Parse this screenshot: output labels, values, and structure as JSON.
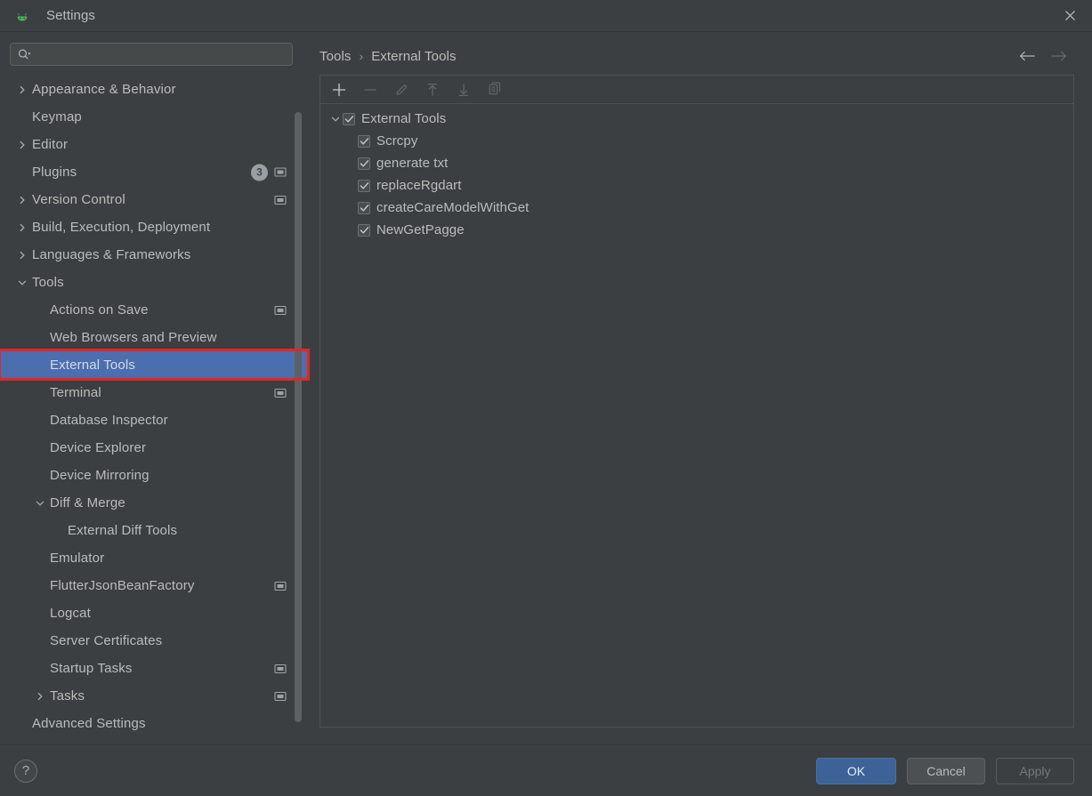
{
  "window": {
    "title": "Settings",
    "app_icon": "android-icon",
    "close_icon": "close-icon"
  },
  "search": {
    "value": "",
    "placeholder": "",
    "icon": "search-icon"
  },
  "sidebar": {
    "items": [
      {
        "label": "Appearance & Behavior",
        "chevron": "chevron-right",
        "indent": 0,
        "selected": false,
        "badge": "",
        "scope_icon": false
      },
      {
        "label": "Keymap",
        "chevron": "none",
        "indent": 0,
        "selected": false,
        "badge": "",
        "scope_icon": false
      },
      {
        "label": "Editor",
        "chevron": "chevron-right",
        "indent": 0,
        "selected": false,
        "badge": "",
        "scope_icon": false
      },
      {
        "label": "Plugins",
        "chevron": "none",
        "indent": 0,
        "selected": false,
        "badge": "3",
        "scope_icon": true
      },
      {
        "label": "Version Control",
        "chevron": "chevron-right",
        "indent": 0,
        "selected": false,
        "badge": "",
        "scope_icon": true
      },
      {
        "label": "Build, Execution, Deployment",
        "chevron": "chevron-right",
        "indent": 0,
        "selected": false,
        "badge": "",
        "scope_icon": false
      },
      {
        "label": "Languages & Frameworks",
        "chevron": "chevron-right",
        "indent": 0,
        "selected": false,
        "badge": "",
        "scope_icon": false
      },
      {
        "label": "Tools",
        "chevron": "chevron-down",
        "indent": 0,
        "selected": false,
        "badge": "",
        "scope_icon": false
      },
      {
        "label": "Actions on Save",
        "chevron": "none",
        "indent": 1,
        "selected": false,
        "badge": "",
        "scope_icon": true
      },
      {
        "label": "Web Browsers and Preview",
        "chevron": "none",
        "indent": 1,
        "selected": false,
        "badge": "",
        "scope_icon": false
      },
      {
        "label": "External Tools",
        "chevron": "none",
        "indent": 1,
        "selected": true,
        "badge": "",
        "scope_icon": false
      },
      {
        "label": "Terminal",
        "chevron": "none",
        "indent": 1,
        "selected": false,
        "badge": "",
        "scope_icon": true
      },
      {
        "label": "Database Inspector",
        "chevron": "none",
        "indent": 1,
        "selected": false,
        "badge": "",
        "scope_icon": false
      },
      {
        "label": "Device Explorer",
        "chevron": "none",
        "indent": 1,
        "selected": false,
        "badge": "",
        "scope_icon": false
      },
      {
        "label": "Device Mirroring",
        "chevron": "none",
        "indent": 1,
        "selected": false,
        "badge": "",
        "scope_icon": false
      },
      {
        "label": "Diff & Merge",
        "chevron": "chevron-down",
        "indent": 1,
        "selected": false,
        "badge": "",
        "scope_icon": false
      },
      {
        "label": "External Diff Tools",
        "chevron": "none",
        "indent": 2,
        "selected": false,
        "badge": "",
        "scope_icon": false
      },
      {
        "label": "Emulator",
        "chevron": "none",
        "indent": 1,
        "selected": false,
        "badge": "",
        "scope_icon": false
      },
      {
        "label": "FlutterJsonBeanFactory",
        "chevron": "none",
        "indent": 1,
        "selected": false,
        "badge": "",
        "scope_icon": true
      },
      {
        "label": "Logcat",
        "chevron": "none",
        "indent": 1,
        "selected": false,
        "badge": "",
        "scope_icon": false
      },
      {
        "label": "Server Certificates",
        "chevron": "none",
        "indent": 1,
        "selected": false,
        "badge": "",
        "scope_icon": false
      },
      {
        "label": "Startup Tasks",
        "chevron": "none",
        "indent": 1,
        "selected": false,
        "badge": "",
        "scope_icon": true
      },
      {
        "label": "Tasks",
        "chevron": "chevron-right",
        "indent": 1,
        "selected": false,
        "badge": "",
        "scope_icon": true
      },
      {
        "label": "Advanced Settings",
        "chevron": "none",
        "indent": 0,
        "selected": false,
        "badge": "",
        "scope_icon": false
      }
    ]
  },
  "breadcrumb": {
    "parent": "Tools",
    "separator": "›",
    "current": "External Tools"
  },
  "navigation": {
    "back_icon": "arrow-left-icon",
    "back_enabled": true,
    "forward_icon": "arrow-right-icon",
    "forward_enabled": false
  },
  "toolbar": {
    "buttons": [
      {
        "name": "add-button",
        "icon": "plus-icon",
        "enabled": true
      },
      {
        "name": "remove-button",
        "icon": "minus-icon",
        "enabled": false
      },
      {
        "name": "edit-button",
        "icon": "pencil-icon",
        "enabled": false
      },
      {
        "name": "move-up-button",
        "icon": "arrow-up-icon",
        "enabled": false
      },
      {
        "name": "move-down-button",
        "icon": "arrow-down-icon",
        "enabled": false
      },
      {
        "name": "copy-button",
        "icon": "copy-icon",
        "enabled": false
      }
    ]
  },
  "tools_tree": {
    "root": {
      "label": "External Tools",
      "checked": true,
      "expanded": true,
      "chevron": "chevron-down"
    },
    "children": [
      {
        "label": "Scrcpy",
        "checked": true
      },
      {
        "label": "generate txt",
        "checked": true
      },
      {
        "label": "replaceRgdart",
        "checked": true
      },
      {
        "label": "createCareModelWithGet",
        "checked": true
      },
      {
        "label": "NewGetPagge",
        "checked": true
      }
    ]
  },
  "footer": {
    "help_label": "?",
    "ok_label": "OK",
    "cancel_label": "Cancel",
    "apply_label": "Apply",
    "apply_enabled": false
  },
  "colors": {
    "background": "#3c3f41",
    "selection_blue": "#4b6eaf",
    "primary_button": "#3c6298",
    "annotation_red": "#e8241f",
    "android_green": "#4caf50",
    "text": "#bbbbbb"
  }
}
